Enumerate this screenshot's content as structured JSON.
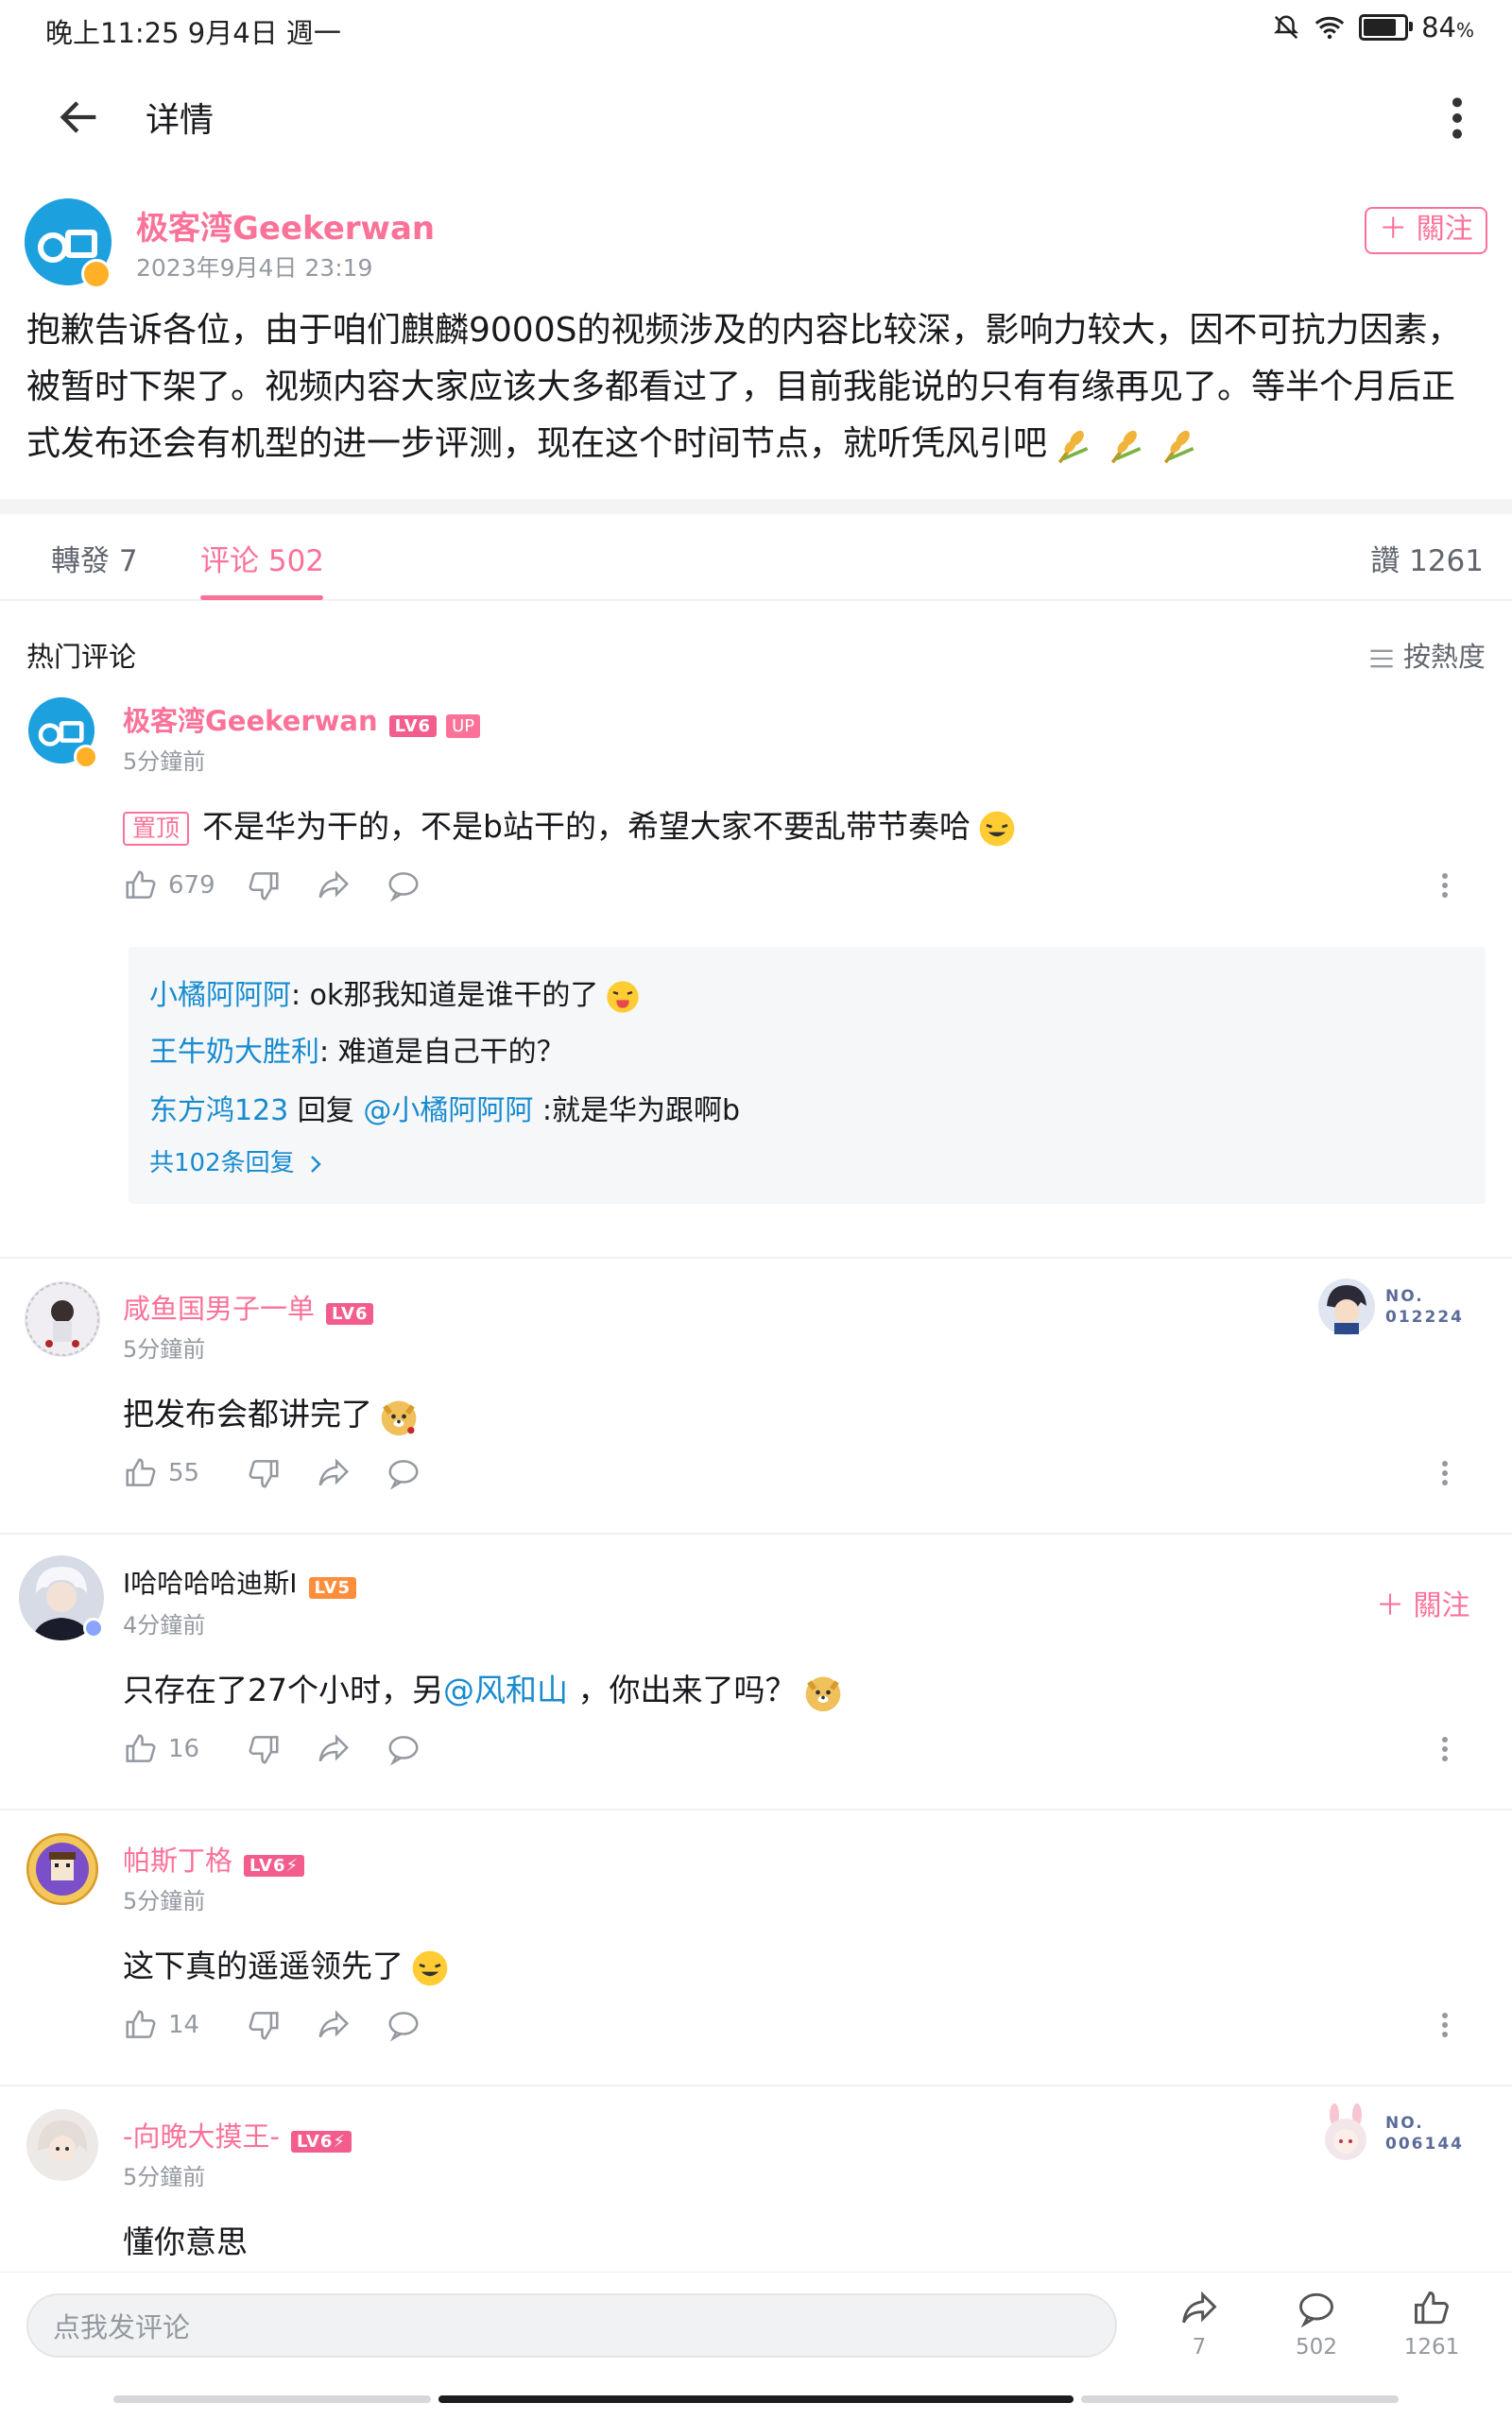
{
  "status": {
    "time": "晚上11:25 9月4日 週一",
    "battery": "84",
    "battery_pct": 84
  },
  "topbar": {
    "title": "详情"
  },
  "post": {
    "author": "极客湾Geekerwan",
    "date": "2023年9月4日 23:19",
    "follow": "关注",
    "follow_label": "＋ 關注",
    "text": "抱歉告诉各位，由于咱们麒麟9000S的视频涉及的内容比较深，影响力较大，因不可抗力因素，被暂时下架了。视频内容大家应该大多都看过了，目前我能说的只有有缘再见了。等半个月后正式发布还会有机型的进一步评测，现在这个时间节点，就听凭风引吧"
  },
  "tabs": {
    "repost": "轉發 7",
    "comment": "评论 502",
    "like": "讚 1261"
  },
  "comments_header": {
    "title": "热门评论",
    "sort": "按熱度"
  },
  "comments": [
    {
      "name": "极客湾Geekerwan",
      "level": "LV6",
      "up": "UP",
      "time": "5分鐘前",
      "pin": "置顶",
      "text": "不是华为干的，不是b站干的，希望大家不要乱带节奏哈",
      "likes": "679",
      "replies": [
        {
          "user": "小橘阿阿阿",
          "text": ": ok那我知道是谁干的了"
        },
        {
          "user": "王牛奶大胜利",
          "text": ": 难道是自己干的？"
        },
        {
          "user": "东方鸿123",
          "mid": " 回复 ",
          "mention": "@小橘阿阿阿",
          "text": " :就是华为跟啊b"
        }
      ],
      "more_replies": "共102条回复"
    },
    {
      "name": "咸鱼国男子一单",
      "level": "LV6",
      "time": "5分鐘前",
      "text": "把发布会都讲完了",
      "likes": "55",
      "fan_no": "NO.",
      "fan_id": "012224"
    },
    {
      "name": "I哈哈哈哈迪斯I",
      "level": "LV5",
      "time": "4分鐘前",
      "text_a": "只存在了27个小时，另",
      "mention": "@风和山",
      "text_b": " ，你出来了吗？",
      "likes": "16",
      "follow": "＋ 關注"
    },
    {
      "name": "帕斯丁格",
      "level": "LV6⚡",
      "time": "5分鐘前",
      "text": "这下真的遥遥领先了",
      "likes": "14"
    },
    {
      "name": "-向晚大摸王-",
      "level": "LV6⚡",
      "time": "5分鐘前",
      "text": "懂你意思",
      "fan_no": "NO.",
      "fan_id": "006144"
    }
  ],
  "bottom": {
    "placeholder": "点我发评论",
    "share_count": "7",
    "comment_count": "502",
    "like_count": "1261"
  },
  "colors": {
    "accent": "#fb7299",
    "link": "#178bcf",
    "brand_blue": "#1da1de"
  }
}
